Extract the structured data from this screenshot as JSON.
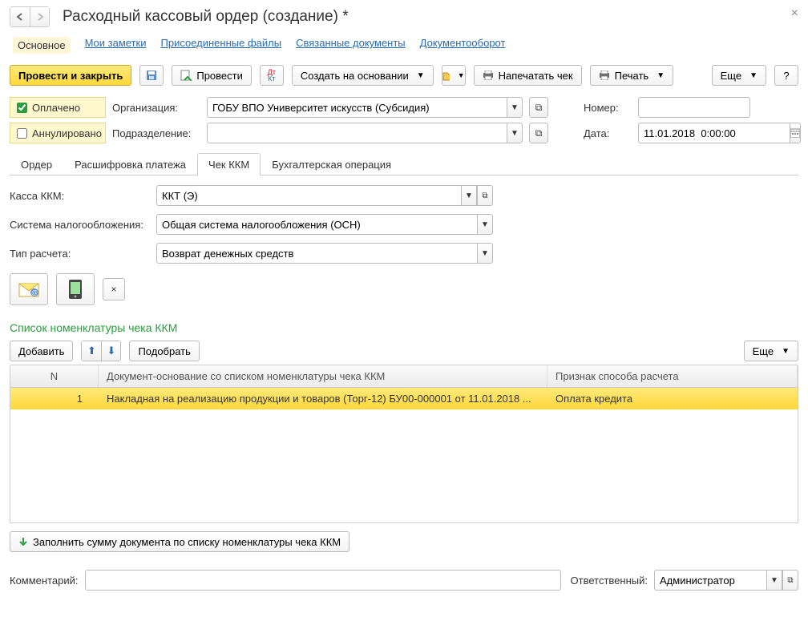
{
  "header": {
    "title": "Расходный кассовый ордер (создание) *"
  },
  "linkbar": {
    "main": "Основное",
    "notes": "Мои заметки",
    "files": "Присоединенные файлы",
    "related": "Связанные документы",
    "docflow": "Документооборот"
  },
  "toolbar": {
    "post_close": "Провести и закрыть",
    "post": "Провести",
    "create_base": "Создать на основании",
    "print_check": "Напечатать чек",
    "print": "Печать",
    "more": "Еще",
    "help": "?"
  },
  "status": {
    "paid": "Оплачено",
    "paid_checked": true,
    "cancelled": "Аннулировано",
    "cancelled_checked": false
  },
  "fields": {
    "org_label": "Организация:",
    "org_value": "ГОБУ ВПО Университет искусств (Субсидия)",
    "dept_label": "Подразделение:",
    "dept_value": "",
    "num_label": "Номер:",
    "num_value": "",
    "date_label": "Дата:",
    "date_value": "11.01.2018  0:00:00"
  },
  "tabs": {
    "order": "Ордер",
    "decrypt": "Расшифровка платежа",
    "check": "Чек ККМ",
    "acct": "Бухгалтерская операция"
  },
  "check": {
    "kkm_label": "Касса ККМ:",
    "kkm_value": "ККТ (Э)",
    "tax_label": "Система налогообложения:",
    "tax_value": "Общая система налогообложения (ОСН)",
    "type_label": "Тип расчета:",
    "type_value": "Возврат денежных средств"
  },
  "section_title": "Список номенклатуры чека ККМ",
  "sub_toolbar": {
    "add": "Добавить",
    "pick": "Подобрать",
    "more": "Еще"
  },
  "table": {
    "cols": {
      "n": "N",
      "doc": "Документ-основание со списком номенклатуры чека ККМ",
      "attr": "Признак способа расчета"
    },
    "rows": [
      {
        "n": "1",
        "doc": "Накладная на реализацию продукции и товаров (Торг-12) БУ00-000001 от 11.01.2018 ...",
        "attr": "Оплата кредита"
      }
    ]
  },
  "fill_btn": "Заполнить сумму документа по списку номенклатуры чека ККМ",
  "footer": {
    "comment_label": "Комментарий:",
    "comment_value": "",
    "resp_label": "Ответственный:",
    "resp_value": "Администратор"
  }
}
